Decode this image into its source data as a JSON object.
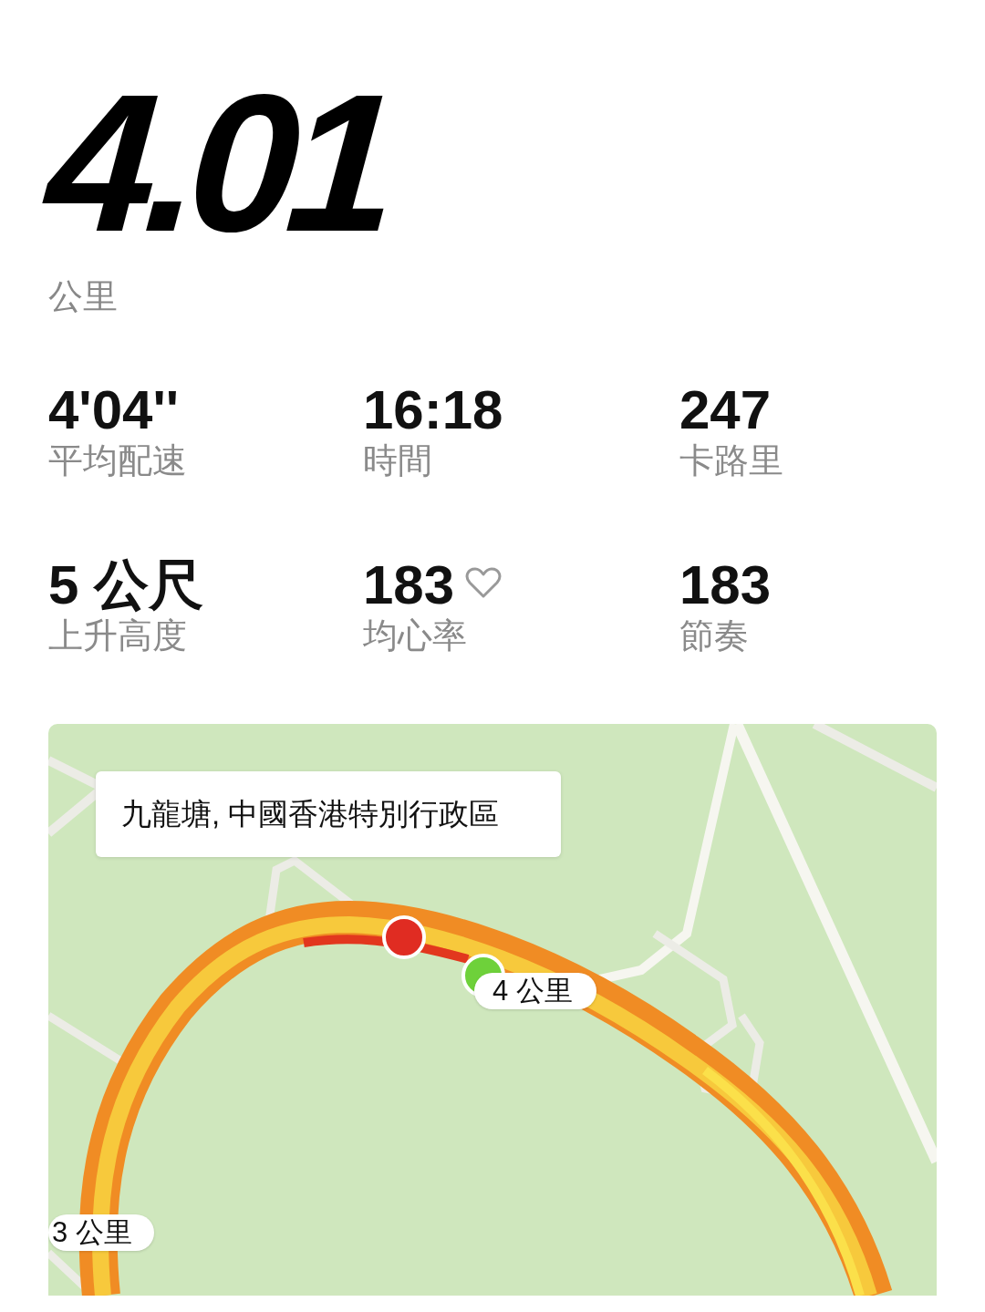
{
  "distance": {
    "value": "4.01",
    "unit": "公里"
  },
  "stats": [
    {
      "kind": "plain",
      "value": "4'04''",
      "label": "平均配速"
    },
    {
      "kind": "plain",
      "value": "16:18",
      "label": "時間"
    },
    {
      "kind": "plain",
      "value": "247",
      "label": "卡路里"
    },
    {
      "kind": "plain",
      "value": "5 公尺",
      "label": "上升高度"
    },
    {
      "kind": "heart",
      "value": "183",
      "label": "均心率"
    },
    {
      "kind": "plain",
      "value": "183",
      "label": "節奏"
    }
  ],
  "map": {
    "kind": "picture",
    "location": "九龍塘, 中國香港特別行政區",
    "markers": [
      {
        "label": "4 公里"
      },
      {
        "label": "3 公里"
      }
    ]
  }
}
